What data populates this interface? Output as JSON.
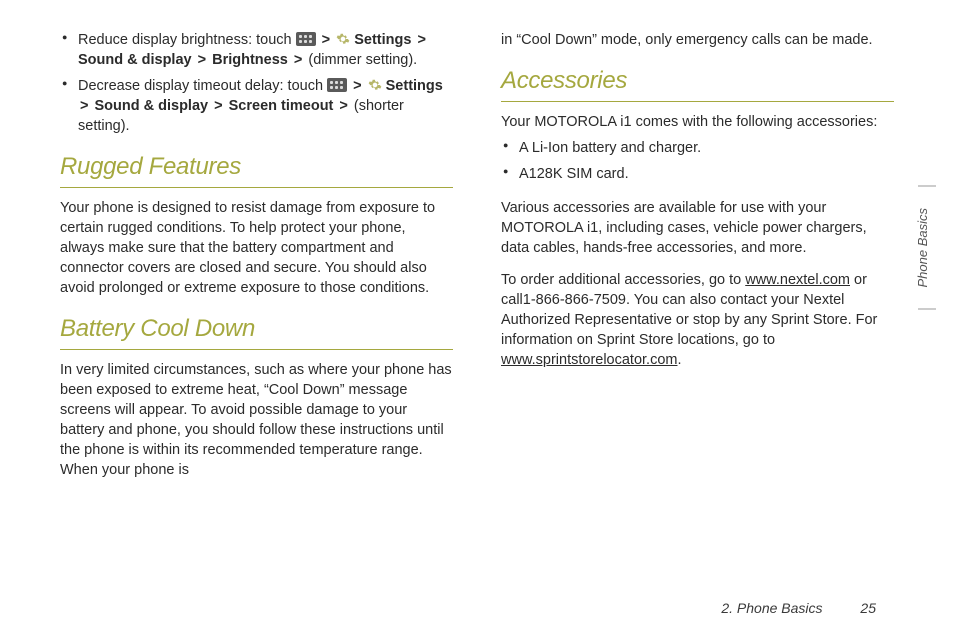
{
  "left": {
    "bullets": [
      {
        "prefix": "Reduce display brightness: touch ",
        "path": [
          "Settings",
          "Sound & display",
          "Brightness"
        ],
        "suffix": " (dimmer setting)."
      },
      {
        "prefix": "Decrease display timeout delay: touch ",
        "path": [
          "Settings",
          "Sound & display",
          "Screen timeout"
        ],
        "suffix": " (shorter setting)."
      }
    ],
    "h_rugged": "Rugged Features",
    "p_rugged": "Your phone is designed to resist damage from exposure to certain rugged conditions. To help protect your phone, always make sure that the battery compartment and connector covers are closed and secure. You should also avoid prolonged or extreme exposure to those conditions.",
    "h_battery": "Battery Cool Down",
    "p_battery": "In very limited circumstances, such as where your phone has been exposed to extreme heat, “Cool Down” message screens will appear. To avoid possible damage to your battery and phone, you should follow these instructions until the phone is within its recommended temperature range. When your phone is"
  },
  "right": {
    "p_cont": "in “Cool Down” mode, only emergency calls can be made.",
    "h_acc": "Accessories",
    "p_acc_intro": "Your MOTOROLA i1 comes with the following accessories:",
    "acc_list": [
      "A Li-Ion battery and charger.",
      "A128K SIM card."
    ],
    "p_acc_more": "Various accessories are available for use with your MOTOROLA i1, including cases, vehicle power chargers, data cables, hands-free accessories, and more.",
    "p_order_1": "To order additional accessories, go to ",
    "link1": "www.nextel.com",
    "p_order_2": " or call1-866-866-7509. You can also contact your Nextel Authorized Representative or stop by any Sprint Store. For information on Sprint Store locations, go to ",
    "link2": "www.sprintstorelocator.com",
    "p_order_3": "."
  },
  "footer": {
    "chapter": "2. Phone Basics",
    "page": "25"
  },
  "sidetab": "Phone Basics",
  "gt": ">"
}
